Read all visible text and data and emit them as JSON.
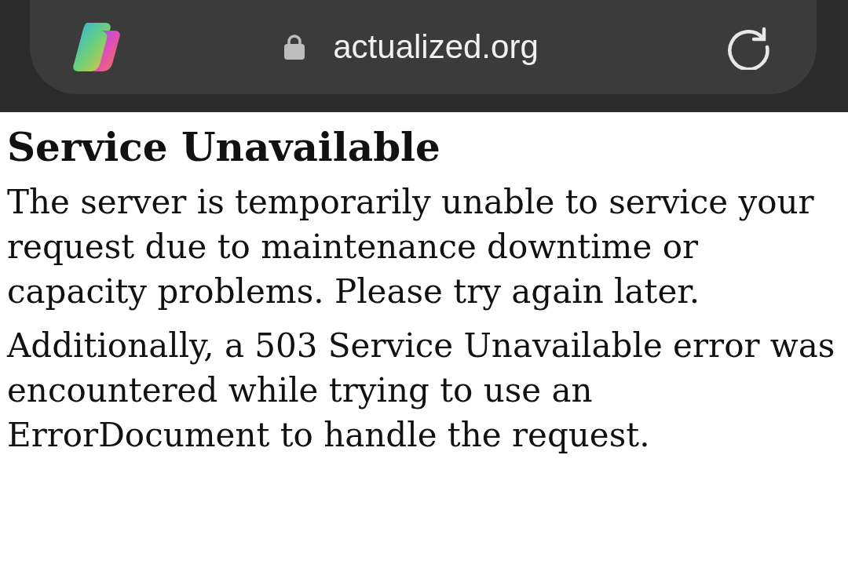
{
  "address_bar": {
    "url": "actualized.org",
    "secure": true
  },
  "page": {
    "heading": "Service Unavailable",
    "paragraphs": [
      "The server is temporarily unable to service your request due to maintenance downtime or capacity problems. Please try again later.",
      "Additionally, a 503 Service Unavailable error was encountered while trying to use an ErrorDocument to handle the request."
    ]
  }
}
